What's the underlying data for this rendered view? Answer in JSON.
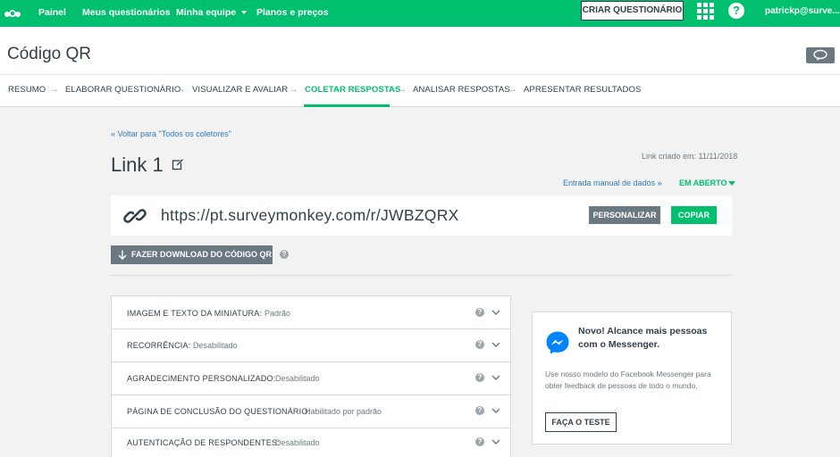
{
  "colors": {
    "brand": "#00bf6f",
    "link": "#2d7bb6",
    "dark": "#333e48",
    "muted": "#6b787f"
  },
  "topnav": {
    "links": [
      "Painel",
      "Meus questionários",
      "Minha equipe",
      "Planos e preços"
    ],
    "create_button": "CRIAR QUESTIONÁRIO",
    "help": "?",
    "user": "patrickp@surve..."
  },
  "header": {
    "title": "Código QR"
  },
  "steps": [
    "RESUMO",
    "ELABORAR QUESTIONÁRIO",
    "VISUALIZAR E AVALIAR",
    "COLETAR RESPOSTAS",
    "ANALISAR RESPOSTAS",
    "APRESENTAR RESULTADOS"
  ],
  "active_step": "COLETAR RESPOSTAS",
  "collector": {
    "back_link": "« Voltar para \"Todos os coletores\"",
    "name": "Link 1",
    "created": "Link criado em: 11/11/2018",
    "manual_entry": "Entrada manual de dados »",
    "status": "EM ABERTO",
    "url": "https://pt.surveymonkey.com/r/JWBZQRX",
    "personalize": "PERSONALIZAR",
    "copy": "COPIAR",
    "download": "FAZER DOWNLOAD DO CÓDIGO QR"
  },
  "settings": [
    {
      "label": "IMAGEM E TEXTO DA MINIATURA:",
      "value": "Padrão"
    },
    {
      "label": "RECORRÊNCIA:",
      "value": "Desabilitado"
    },
    {
      "label": "AGRADECIMENTO PERSONALIZADO:",
      "value": "Desabilitado"
    },
    {
      "label": "PÁGINA DE CONCLUSÃO DO QUESTIONÁRIO:",
      "value": "Habilitado por padrão"
    },
    {
      "label": "AUTENTICAÇÃO DE RESPONDENTES:",
      "value": "Desabilitado"
    }
  ],
  "promo": {
    "title": "Novo! Alcance mais pessoas com o Messenger.",
    "body": "Use nosso modelo do Facebook Messenger para obter feedback de pessoas de todo o mundo.",
    "button": "FAÇA O TESTE"
  }
}
